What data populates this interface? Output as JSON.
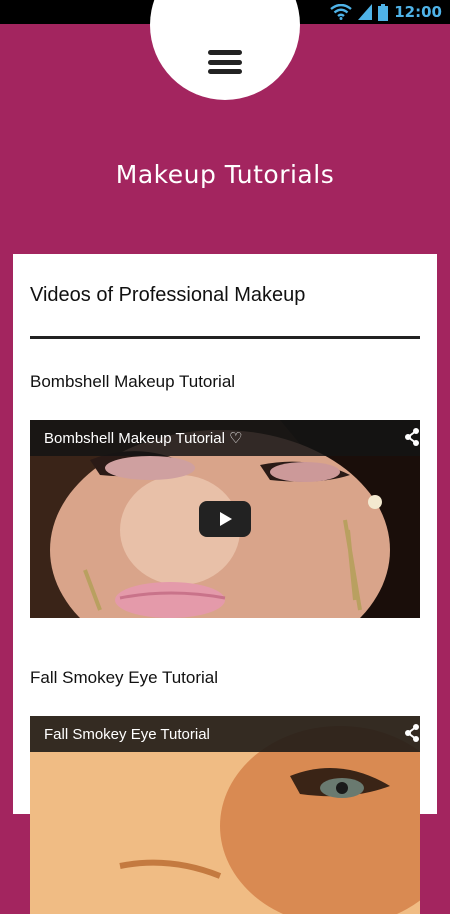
{
  "status_bar": {
    "time": "12:00",
    "icons": [
      "wifi-icon",
      "signal-icon",
      "battery-icon"
    ]
  },
  "header": {
    "title": "Makeup Tutorials",
    "menu_icon": "hamburger-menu-icon"
  },
  "content": {
    "section_title": "Videos of Professional Makeup",
    "videos": [
      {
        "title": "Bombshell Makeup Tutorial",
        "overlay_title": "Bombshell Makeup Tutorial ♡"
      },
      {
        "title": "Fall Smokey Eye Tutorial",
        "overlay_title": "Fall Smokey Eye Tutorial"
      }
    ]
  },
  "colors": {
    "primary": "#a3255f",
    "status_bar": "#000000",
    "status_accent": "#4fb3e8"
  }
}
